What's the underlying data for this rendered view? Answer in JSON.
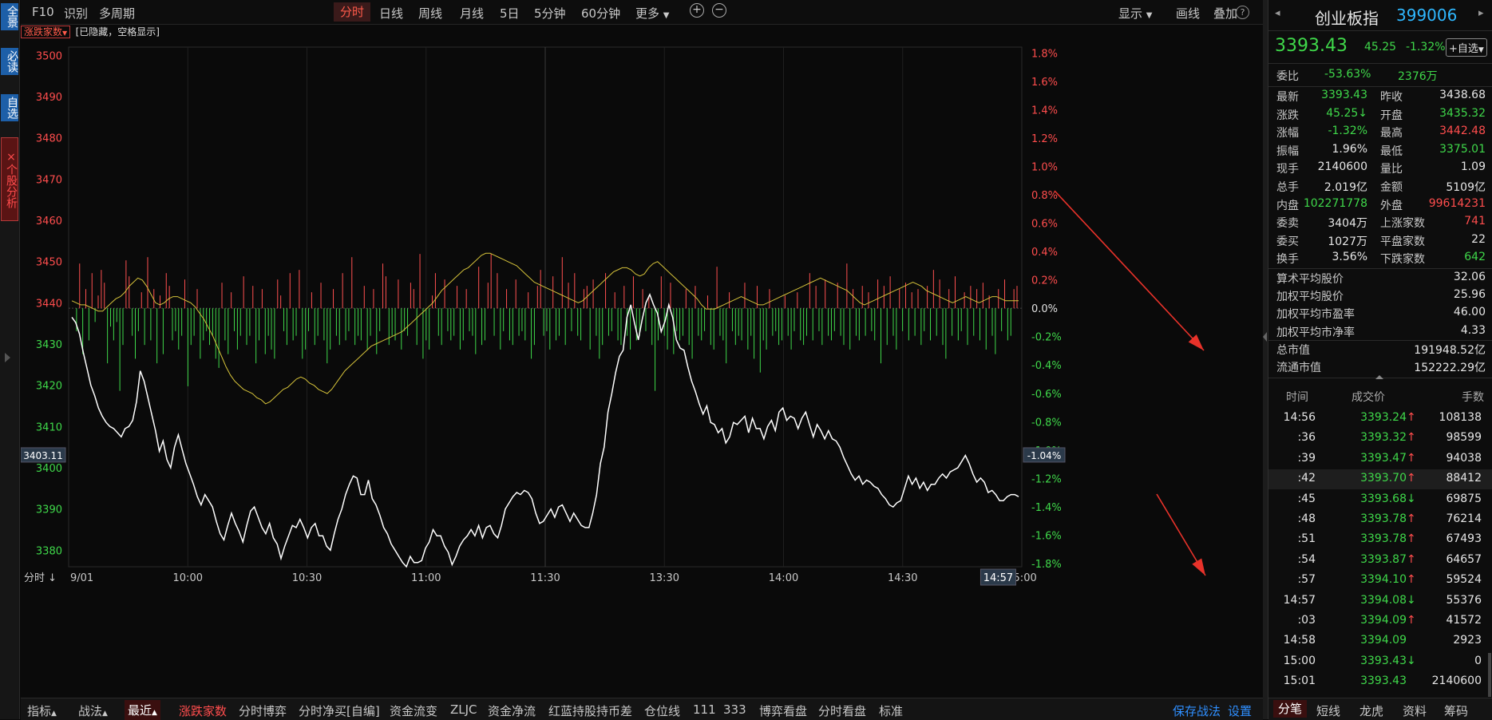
{
  "left_tabs": [
    "全景",
    "必读",
    "自选",
    "个股分析"
  ],
  "left_tab_close": "×",
  "top": {
    "left_items": [
      "F10",
      "识别",
      "多周期"
    ],
    "periods": [
      "分时",
      "日线",
      "周线",
      "月线",
      "5日",
      "5分钟",
      "60分钟",
      "更多"
    ],
    "right_items": [
      "显示",
      "画线",
      "叠加"
    ],
    "help": "?"
  },
  "subbar": {
    "badge": "涨跌家数",
    "hint": "[已隐藏，空格显示]"
  },
  "chart_data": {
    "type": "line",
    "title": "",
    "prev_close": 3438.68,
    "y_left_ticks": [
      3500,
      3490,
      3480,
      3470,
      3460,
      3450,
      3440,
      3430,
      3420,
      3410,
      3400,
      3390,
      3380
    ],
    "y_left_tick_labels": [
      "3500",
      "3490",
      "3480",
      "3470",
      "3460",
      "3450",
      "3440",
      "3430",
      "3420",
      "3410",
      "3400",
      "3390",
      "3380"
    ],
    "y_right_ticks": [
      "1.8%",
      "1.6%",
      "1.4%",
      "1.2%",
      "1.0%",
      "0.8%",
      "0.6%",
      "0.4%",
      "0.2%",
      "0.0%",
      "-0.2%",
      "-0.4%",
      "-0.6%",
      "-0.8%",
      "-1.0%",
      "-1.2%",
      "-1.4%",
      "-1.6%",
      "-1.8%"
    ],
    "ylim": [
      3376,
      3502
    ],
    "x_labels": [
      "9/01",
      "10:00",
      "10:30",
      "11:00",
      "11:30",
      "13:30",
      "14:00",
      "14:30",
      "15:00"
    ],
    "price_readout": "3403.11",
    "percent_readout": "-1.04%",
    "time_readout": "14:57",
    "price": [
      3436.5,
      3435.2,
      3432.5,
      3428.0,
      3424.0,
      3420.0,
      3417.5,
      3414.5,
      3412.5,
      3411.0,
      3410.0,
      3409.5,
      3408.5,
      3407.5,
      3409.5,
      3410.0,
      3411.5,
      3416.0,
      3423.5,
      3421.0,
      3417.0,
      3413.0,
      3409.0,
      3404.0,
      3406.5,
      3402.0,
      3400.0,
      3405.0,
      3408.0,
      3404.5,
      3401.0,
      3398.5,
      3396.0,
      3393.0,
      3391.0,
      3393.5,
      3392.0,
      3390.5,
      3387.0,
      3384.0,
      3382.5,
      3386.0,
      3389.0,
      3386.5,
      3384.5,
      3382.0,
      3386.0,
      3389.5,
      3390.5,
      3388.0,
      3385.5,
      3384.0,
      3386.5,
      3383.0,
      3381.5,
      3378.0,
      3381.0,
      3383.5,
      3386.0,
      3385.5,
      3387.5,
      3385.5,
      3383.0,
      3385.5,
      3386.5,
      3383.5,
      3383.5,
      3381.0,
      3380.0,
      3384.0,
      3387.5,
      3390.0,
      3393.5,
      3396.0,
      3398.0,
      3397.5,
      3393.5,
      3393.5,
      3397.0,
      3392.5,
      3391.0,
      3388.5,
      3385.5,
      3384.0,
      3381.5,
      3380.0,
      3378.5,
      3377.0,
      3376.0,
      3378.5,
      3377.0,
      3377.0,
      3377.5,
      3380.5,
      3382.0,
      3385.0,
      3383.5,
      3383.5,
      3381.0,
      3379.5,
      3376.5,
      3378.5,
      3381.0,
      3382.5,
      3383.5,
      3385.0,
      3383.5,
      3386.0,
      3383.0,
      3385.5,
      3386.0,
      3384.0,
      3383.0,
      3386.0,
      3390.0,
      3391.5,
      3393.0,
      3394.0,
      3393.5,
      3394.5,
      3394.0,
      3392.5,
      3389.0,
      3386.5,
      3387.0,
      3388.5,
      3390.0,
      3388.0,
      3390.5,
      3391.0,
      3389.0,
      3387.0,
      3389.0,
      3387.5,
      3386.0,
      3385.5,
      3385.5,
      3389.0,
      3393.5,
      3401.0,
      3405.0,
      3413.5,
      3418.0,
      3423.0,
      3427.0,
      3428.5,
      3436.5,
      3439.5,
      3435.0,
      3431.0,
      3436.0,
      3440.0,
      3442.0,
      3439.5,
      3437.5,
      3433.0,
      3435.5,
      3439.5,
      3436.5,
      3431.0,
      3429.0,
      3428.5,
      3424.5,
      3421.0,
      3418.5,
      3415.5,
      3413.0,
      3415.0,
      3411.0,
      3410.5,
      3408.5,
      3409.5,
      3406.0,
      3407.5,
      3411.0,
      3410.5,
      3411.5,
      3412.5,
      3408.5,
      3412.0,
      3409.5,
      3409.5,
      3407.0,
      3410.0,
      3411.5,
      3409.0,
      3413.5,
      3414.5,
      3411.5,
      3412.5,
      3412.0,
      3409.5,
      3412.0,
      3413.5,
      3410.5,
      3407.5,
      3410.5,
      3409.0,
      3407.0,
      3409.0,
      3407.0,
      3406.5,
      3405.0,
      3402.5,
      3400.5,
      3398.5,
      3397.0,
      3398.0,
      3396.0,
      3397.0,
      3396.5,
      3395.5,
      3395.0,
      3393.5,
      3392.5,
      3391.0,
      3390.5,
      3391.5,
      3392.0,
      3395.0,
      3398.0,
      3396.0,
      3397.5,
      3395.0,
      3396.5,
      3394.5,
      3396.0,
      3396.0,
      3397.5,
      3398.5,
      3397.5,
      3399.0,
      3399.5,
      3400.0,
      3401.5,
      3403.0,
      3401.0,
      3398.5,
      3396.5,
      3397.5,
      3396.5,
      3394.0,
      3394.5,
      3393.5,
      3392.0,
      3392.0,
      3393.0,
      3393.5,
      3393.5,
      3393.0
    ],
    "avg": [
      3440.5,
      3440.0,
      3439.5,
      3439.5,
      3439.0,
      3438.5,
      3438.0,
      3438.0,
      3439.0,
      3440.0,
      3441.0,
      3441.5,
      3442.5,
      3444.0,
      3445.0,
      3446.0,
      3445.5,
      3444.0,
      3442.0,
      3440.0,
      3439.5,
      3440.0,
      3441.0,
      3441.5,
      3441.5,
      3441.0,
      3440.5,
      3440.0,
      3439.0,
      3437.5,
      3436.0,
      3434.0,
      3432.0,
      3429.5,
      3427.0,
      3424.5,
      3422.5,
      3421.0,
      3420.0,
      3419.0,
      3418.5,
      3418.0,
      3417.0,
      3416.5,
      3415.5,
      3416.0,
      3417.0,
      3418.0,
      3419.0,
      3419.5,
      3420.5,
      3421.5,
      3422.0,
      3421.5,
      3420.5,
      3420.0,
      3419.0,
      3418.5,
      3418.0,
      3419.0,
      3420.5,
      3422.0,
      3423.5,
      3424.5,
      3425.5,
      3426.5,
      3427.5,
      3428.5,
      3429.5,
      3430.0,
      3430.5,
      3431.0,
      3431.5,
      3432.0,
      3432.5,
      3433.0,
      3434.0,
      3435.0,
      3436.0,
      3437.0,
      3438.0,
      3439.0,
      3440.0,
      3441.5,
      3443.0,
      3444.0,
      3445.0,
      3446.0,
      3447.0,
      3448.0,
      3448.5,
      3449.5,
      3450.5,
      3451.5,
      3452.0,
      3452.0,
      3451.5,
      3451.0,
      3450.5,
      3450.0,
      3449.5,
      3449.0,
      3448.0,
      3447.0,
      3446.0,
      3445.0,
      3444.5,
      3444.0,
      3443.5,
      3443.0,
      3442.5,
      3442.0,
      3441.5,
      3441.0,
      3440.5,
      3440.0,
      3440.5,
      3441.5,
      3442.5,
      3443.5,
      3444.5,
      3445.5,
      3446.5,
      3447.5,
      3448.0,
      3448.5,
      3448.5,
      3448.0,
      3447.0,
      3446.5,
      3447.0,
      3448.5,
      3449.5,
      3450.0,
      3449.0,
      3448.0,
      3447.0,
      3446.0,
      3445.0,
      3444.0,
      3443.0,
      3442.0,
      3441.0,
      3439.5,
      3438.5,
      3438.5,
      3438.5,
      3439.0,
      3439.5,
      3440.0,
      3440.5,
      3441.0,
      3441.5,
      3441.0,
      3440.5,
      3440.0,
      3439.5,
      3439.5,
      3440.0,
      3440.5,
      3441.0,
      3441.5,
      3442.0,
      3442.5,
      3443.0,
      3443.5,
      3444.0,
      3444.5,
      3445.0,
      3445.5,
      3446.0,
      3445.5,
      3445.0,
      3444.5,
      3444.0,
      3443.5,
      3443.0,
      3442.0,
      3441.0,
      3440.0,
      3439.5,
      3440.0,
      3440.5,
      3441.0,
      3441.5,
      3442.0,
      3442.5,
      3443.0,
      3443.5,
      3444.0,
      3444.5,
      3445.0,
      3444.5,
      3444.0,
      3443.0,
      3442.5,
      3442.0,
      3441.5,
      3441.0,
      3440.5,
      3440.0,
      3440.5,
      3441.0,
      3441.5,
      3441.0,
      3440.5,
      3440.0,
      3440.5,
      3441.0,
      3441.5,
      3441.5,
      3441.0,
      3440.5,
      3440.5,
      3440.5,
      3440.5
    ],
    "vol_up_x": [
      2,
      4,
      6,
      8,
      9,
      10,
      17,
      18,
      22,
      24,
      26,
      28,
      30,
      31,
      36,
      40,
      48,
      51,
      55,
      58,
      61,
      66,
      67,
      70,
      73,
      77,
      80,
      84,
      87,
      90,
      94,
      97,
      100,
      101,
      105,
      109,
      110,
      112,
      116,
      117,
      120,
      124,
      127,
      131,
      134,
      135,
      137,
      140,
      143,
      147,
      150,
      151,
      155,
      158,
      160,
      162,
      165,
      166,
      168,
      172,
      175,
      178,
      181,
      184,
      186,
      190,
      193,
      198,
      201,
      205,
      208,
      212,
      217,
      221,
      225,
      230,
      234,
      238,
      240,
      243,
      247,
      250,
      252,
      255,
      257,
      260,
      262,
      264,
      267,
      269,
      271,
      273,
      276,
      278,
      280,
      283,
      285,
      288,
      290,
      292,
      294,
      296,
      299,
      301,
      304,
      305
    ],
    "vol_up_h": [
      0.7,
      0.3,
      0.55,
      0.2,
      0.6,
      0.4,
      0.75,
      0.5,
      0.25,
      0.8,
      0.3,
      0.2,
      0.55,
      0.35,
      0.45,
      0.3,
      0.4,
      0.25,
      0.5,
      0.35,
      0.3,
      0.45,
      0.2,
      0.55,
      0.6,
      0.25,
      0.4,
      0.3,
      0.55,
      0.8,
      0.35,
      0.3,
      0.7,
      0.5,
      0.45,
      0.4,
      0.3,
      0.85,
      0.2,
      0.55,
      0.45,
      0.35,
      0.3,
      0.65,
      0.4,
      0.85,
      0.55,
      0.3,
      0.45,
      0.25,
      0.35,
      0.6,
      0.5,
      0.8,
      0.4,
      0.55,
      0.3,
      0.35,
      0.45,
      0.55,
      0.25,
      0.35,
      0.5,
      0.3,
      0.2,
      0.5,
      0.4,
      0.3,
      0.35,
      0.2,
      0.65,
      0.25,
      0.4,
      0.35,
      0.3,
      0.2,
      0.25,
      0.55,
      0.35,
      0.45,
      0.4,
      0.7,
      0.3,
      0.35,
      0.25,
      0.45,
      0.35,
      0.5,
      0.3,
      0.4,
      0.25,
      0.3,
      0.35,
      0.6,
      0.45,
      0.3,
      0.5,
      0.25,
      0.35,
      0.3,
      0.4,
      0.2,
      0.3,
      0.45,
      0.3,
      0.35
    ],
    "vol_dn_x": [
      1,
      3,
      5,
      7,
      11,
      12,
      13,
      14,
      15,
      16,
      19,
      20,
      21,
      23,
      25,
      27,
      29,
      32,
      33,
      34,
      35,
      37,
      38,
      39,
      41,
      42,
      43,
      44,
      45,
      46,
      47,
      49,
      50,
      52,
      53,
      54,
      56,
      57,
      59,
      60,
      62,
      63,
      64,
      65,
      68,
      69,
      71,
      72,
      74,
      75,
      76,
      78,
      79,
      81,
      82,
      83,
      85,
      86,
      88,
      89,
      91,
      92,
      93,
      95,
      96,
      98,
      99,
      102,
      103,
      104,
      106,
      107,
      108,
      111,
      113,
      114,
      115,
      118,
      119,
      121,
      122,
      123,
      125,
      126,
      128,
      129,
      130,
      132,
      133,
      136,
      138,
      139,
      141,
      142,
      144,
      145,
      146,
      148,
      149,
      152,
      153,
      154,
      156,
      157,
      159,
      161,
      163,
      164,
      167,
      169,
      170,
      171,
      173,
      174,
      176,
      177,
      179,
      180,
      182,
      183,
      185,
      187,
      188,
      189,
      191,
      192,
      194,
      195,
      196,
      197,
      199,
      200,
      202,
      203,
      204,
      206,
      207,
      209,
      210,
      211,
      213,
      214,
      215,
      216,
      218,
      219,
      220,
      222,
      223,
      224,
      226,
      227,
      228,
      229,
      231,
      232,
      233,
      235,
      236,
      237,
      239,
      241,
      242,
      244,
      245,
      246,
      248,
      249,
      251,
      253,
      254,
      256,
      258,
      259,
      261,
      263,
      265,
      266,
      268,
      270,
      272,
      274,
      275,
      277,
      279,
      281,
      282,
      284,
      286,
      287,
      289,
      291,
      293,
      295,
      297,
      298,
      300,
      302,
      303
    ],
    "vol_dn_h": [
      0.25,
      0.5,
      0.35,
      0.15,
      0.6,
      0.2,
      0.35,
      0.15,
      0.9,
      0.4,
      0.3,
      0.55,
      0.25,
      0.4,
      0.35,
      0.6,
      0.5,
      0.35,
      0.25,
      0.45,
      0.3,
      0.85,
      0.4,
      0.3,
      0.55,
      0.35,
      0.25,
      0.4,
      0.3,
      0.55,
      0.65,
      0.35,
      0.5,
      0.25,
      0.45,
      0.3,
      0.4,
      0.3,
      0.6,
      0.35,
      0.5,
      0.3,
      0.45,
      0.55,
      0.25,
      0.4,
      0.35,
      0.3,
      0.55,
      0.45,
      0.25,
      0.4,
      0.3,
      0.35,
      0.6,
      0.45,
      0.3,
      0.4,
      0.35,
      0.25,
      0.4,
      0.3,
      0.35,
      0.45,
      0.3,
      0.5,
      0.25,
      0.4,
      0.3,
      0.35,
      0.45,
      0.25,
      0.3,
      0.4,
      0.55,
      0.35,
      0.45,
      0.3,
      0.4,
      0.25,
      0.35,
      0.3,
      0.45,
      0.35,
      0.25,
      0.3,
      0.5,
      0.4,
      0.35,
      0.3,
      0.45,
      0.25,
      0.35,
      0.4,
      0.3,
      0.25,
      0.35,
      0.55,
      0.4,
      0.3,
      0.25,
      0.45,
      0.35,
      0.3,
      0.4,
      0.25,
      0.3,
      0.35,
      0.45,
      0.3,
      0.55,
      0.4,
      0.3,
      0.25,
      0.35,
      0.4,
      0.3,
      0.45,
      0.35,
      0.3,
      0.25,
      0.4,
      0.9,
      0.35,
      0.3,
      0.45,
      0.5,
      0.25,
      0.35,
      0.3,
      0.4,
      0.55,
      0.3,
      0.35,
      0.25,
      0.4,
      0.45,
      0.3,
      0.35,
      0.6,
      0.25,
      0.4,
      0.3,
      0.35,
      0.45,
      0.3,
      0.55,
      0.7,
      0.35,
      0.45,
      0.3,
      0.25,
      0.4,
      0.35,
      0.3,
      0.45,
      0.25,
      0.35,
      0.4,
      0.3,
      0.35,
      0.25,
      0.4,
      0.3,
      0.35,
      0.25,
      0.3,
      0.4,
      0.45,
      0.3,
      0.35,
      0.3,
      0.25,
      0.35,
      0.6,
      0.4,
      0.3,
      0.45,
      0.25,
      0.35,
      0.3,
      0.4,
      0.25,
      0.35,
      0.3,
      0.4,
      0.55,
      0.3,
      0.35,
      0.25,
      0.4,
      0.3,
      0.35,
      0.45,
      0.3,
      0.5,
      0.25,
      0.35,
      0.3,
      0.4,
      0.55,
      0.35,
      0.3,
      0.25,
      0.45,
      0.35,
      0.3,
      0.25,
      0.4,
      0.2,
      0.35,
      0.3,
      0.25,
      0.35,
      0.2,
      0.25,
      0.65,
      0.3,
      0.2,
      0.25,
      0.3
    ]
  },
  "bottom": {
    "left_items": [
      "指标",
      "战法",
      "最近"
    ],
    "active_item": "涨跌家数",
    "items": [
      "分时博弈",
      "分时净买[自编]",
      "资金流变",
      "ZLJC",
      "资金净流",
      "红蓝持股持币差",
      "仓位线",
      "111",
      "333",
      "博弈看盘",
      "分时看盘",
      "标准"
    ],
    "right_items": [
      "保存战法",
      "设置"
    ],
    "time_bar_label": "分时"
  },
  "quote": {
    "name": "创业板指",
    "code": "399006",
    "price": "3393.43",
    "change": "45.25",
    "change_pct": "-1.32%",
    "add_button": "+自选",
    "weibi_label": "委比",
    "weibi_value": "-53.63%",
    "weibi_amount": "2376万",
    "rows": [
      {
        "l1": "最新",
        "v1": "3393.43",
        "c1": "green",
        "l2": "昨收",
        "v2": "3438.68",
        "c2": "white"
      },
      {
        "l1": "涨跌",
        "v1": "45.25↓",
        "c1": "green",
        "l2": "开盘",
        "v2": "3435.32",
        "c2": "green"
      },
      {
        "l1": "涨幅",
        "v1": "-1.32%",
        "c1": "green",
        "l2": "最高",
        "v2": "3442.48",
        "c2": "red"
      },
      {
        "l1": "振幅",
        "v1": "1.96%",
        "c1": "white",
        "l2": "最低",
        "v2": "3375.01",
        "c2": "green"
      },
      {
        "l1": "现手",
        "v1": "2140600",
        "c1": "white",
        "l2": "量比",
        "v2": "1.09",
        "c2": "white"
      },
      {
        "l1": "总手",
        "v1": "2.019亿",
        "c1": "white",
        "l2": "金额",
        "v2": "5109亿",
        "c2": "white"
      },
      {
        "l1": "内盘",
        "v1": "102271778",
        "c1": "green",
        "l2": "外盘",
        "v2": "99614231",
        "c2": "red"
      },
      {
        "l1": "委卖",
        "v1": "3404万",
        "c1": "white",
        "l2": "上涨家数",
        "v2": "741",
        "c2": "red"
      },
      {
        "l1": "委买",
        "v1": "1027万",
        "c1": "white",
        "l2": "平盘家数",
        "v2": "22",
        "c2": "white"
      },
      {
        "l1": "换手",
        "v1": "3.56%",
        "c1": "white",
        "l2": "下跌家数",
        "v2": "642",
        "c2": "green"
      }
    ],
    "stats": [
      {
        "label": "算术平均股价",
        "value": "32.06"
      },
      {
        "label": "加权平均股价",
        "value": "25.96"
      },
      {
        "label": "加权平均市盈率",
        "value": "46.00"
      },
      {
        "label": "加权平均市净率",
        "value": "4.33"
      },
      {
        "label": "总市值",
        "value": "191948.52亿"
      },
      {
        "label": "流通市值",
        "value": "152222.29亿"
      }
    ]
  },
  "ticks": {
    "headers": [
      "时间",
      "成交价",
      "手数"
    ],
    "rows": [
      {
        "t": "14:56",
        "p": "3393.24",
        "a": "↑",
        "v": "108138"
      },
      {
        "t": ":36",
        "p": "3393.32",
        "a": "↑",
        "v": "98599"
      },
      {
        "t": ":39",
        "p": "3393.47",
        "a": "↑",
        "v": "94038"
      },
      {
        "t": ":42",
        "p": "3393.70",
        "a": "↑",
        "v": "88412"
      },
      {
        "t": ":45",
        "p": "3393.68",
        "a": "↓",
        "v": "69875"
      },
      {
        "t": ":48",
        "p": "3393.78",
        "a": "↑",
        "v": "76214"
      },
      {
        "t": ":51",
        "p": "3393.78",
        "a": "↑",
        "v": "67493"
      },
      {
        "t": ":54",
        "p": "3393.87",
        "a": "↑",
        "v": "64657"
      },
      {
        "t": ":57",
        "p": "3394.10",
        "a": "↑",
        "v": "59524"
      },
      {
        "t": "14:57",
        "p": "3394.08",
        "a": "↓",
        "v": "55376"
      },
      {
        "t": ":03",
        "p": "3394.09",
        "a": "↑",
        "v": "41572"
      },
      {
        "t": "14:58",
        "p": "3394.09",
        "a": "",
        "v": "2923"
      },
      {
        "t": "15:00",
        "p": "3393.43",
        "a": "↓",
        "v": "0"
      },
      {
        "t": "15:01",
        "p": "3393.43",
        "a": "",
        "v": "2140600"
      }
    ],
    "tabs": [
      "分笔",
      "短线",
      "龙虎",
      "资料",
      "筹码"
    ]
  }
}
